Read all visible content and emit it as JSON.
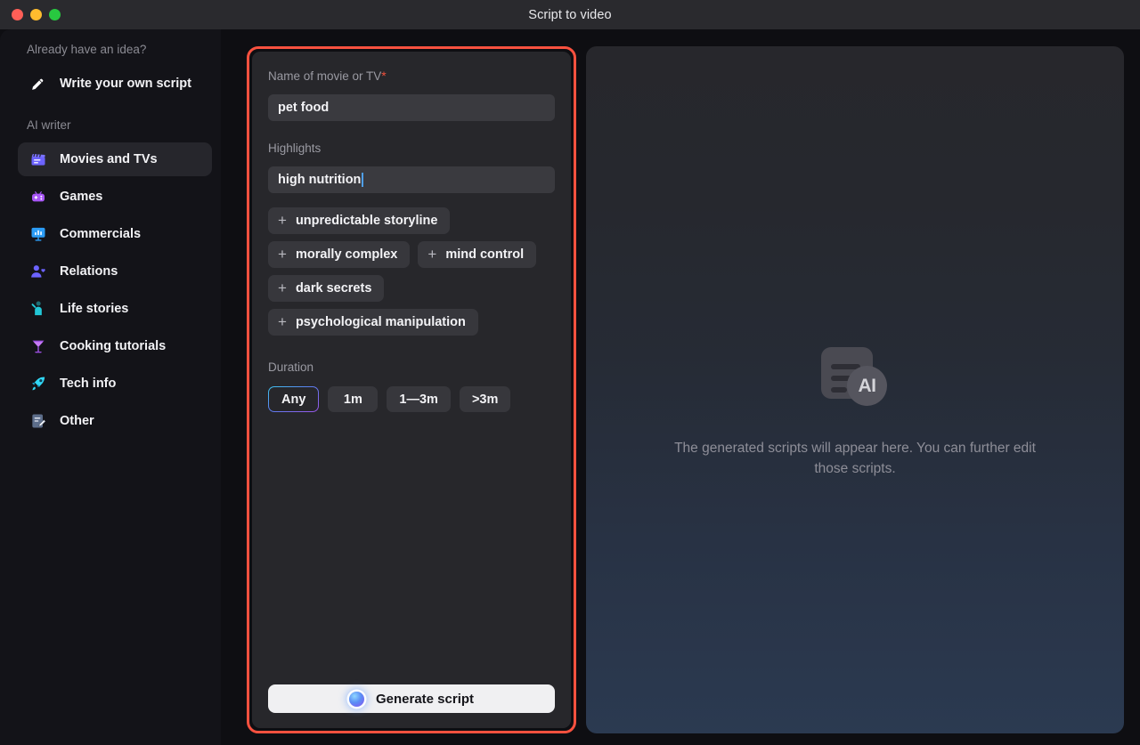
{
  "window": {
    "title": "Script to video",
    "traffic_lights": [
      {
        "name": "close",
        "color": "#ff5f57"
      },
      {
        "name": "minimize",
        "color": "#febc2e"
      },
      {
        "name": "zoom",
        "color": "#28c840"
      }
    ]
  },
  "sidebar": {
    "idea_section_label": "Already have an idea?",
    "write_own_script": {
      "label": "Write your own script",
      "icon": "pencil-icon"
    },
    "ai_writer_label": "AI writer",
    "items": [
      {
        "label": "Movies and TVs",
        "icon": "clapperboard-icon",
        "selected": true
      },
      {
        "label": "Games",
        "icon": "gamepad-icon",
        "selected": false
      },
      {
        "label": "Commercials",
        "icon": "presentation-chart-icon",
        "selected": false
      },
      {
        "label": "Relations",
        "icon": "person-heart-icon",
        "selected": false
      },
      {
        "label": "Life stories",
        "icon": "person-waving-icon",
        "selected": false
      },
      {
        "label": "Cooking tutorials",
        "icon": "cocktail-glass-icon",
        "selected": false
      },
      {
        "label": "Tech info",
        "icon": "rocket-icon",
        "selected": false
      },
      {
        "label": "Other",
        "icon": "note-edit-icon",
        "selected": false
      }
    ]
  },
  "form": {
    "highlight_border_color": "#f9513f",
    "name_label": "Name of movie or TV",
    "name_required_mark": "*",
    "name_value": "pet food",
    "name_placeholder": "Name of movie or TV",
    "highlights_label": "Highlights",
    "highlights_value": "high nutrition",
    "highlights_placeholder": "Highlights",
    "suggestion_chips": [
      {
        "label": "unpredictable storyline",
        "add_icon": "plus-icon"
      },
      {
        "label": "morally complex",
        "add_icon": "plus-icon"
      },
      {
        "label": "mind control",
        "add_icon": "plus-icon"
      },
      {
        "label": "dark secrets",
        "add_icon": "plus-icon"
      },
      {
        "label": "psychological manipulation",
        "add_icon": "plus-icon"
      }
    ],
    "duration_label": "Duration",
    "duration_options": [
      {
        "label": "Any",
        "selected": true
      },
      {
        "label": "1m",
        "selected": false
      },
      {
        "label": "1—3m",
        "selected": false
      },
      {
        "label": ">3m",
        "selected": false
      }
    ],
    "generate_label": "Generate script",
    "generate_icon": "ai-orb-icon"
  },
  "preview": {
    "empty_icon": "document-ai-icon",
    "ai_badge_text": "AI",
    "empty_message": "The generated scripts will appear here. You can further edit those scripts."
  }
}
